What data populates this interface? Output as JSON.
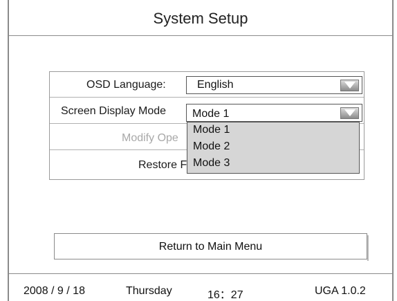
{
  "window": {
    "title": "System Setup"
  },
  "settings": {
    "osd_language": {
      "label": "OSD Language:",
      "value": "English"
    },
    "screen_display_mode": {
      "label": "Screen Display Mode",
      "value": "Mode 1"
    },
    "modify_operation": {
      "label": "Modify Ope"
    },
    "restore": {
      "label": "Restore F"
    }
  },
  "dropdown": {
    "options": [
      "Mode 1",
      "Mode 2",
      "Mode 3"
    ]
  },
  "buttons": {
    "return_label": "Return to Main Menu"
  },
  "status": {
    "date": "2008 / 9 / 18",
    "weekday": "Thursday",
    "time": "16：27",
    "version": "UGA 1.0.2"
  },
  "icons": {
    "dropdown_arrow": "chevron-down-icon"
  },
  "colors": {
    "dropdown_list_bg": "#d6d6d6",
    "disabled_text": "#a8a8a8",
    "border": "#8a8a8a"
  }
}
